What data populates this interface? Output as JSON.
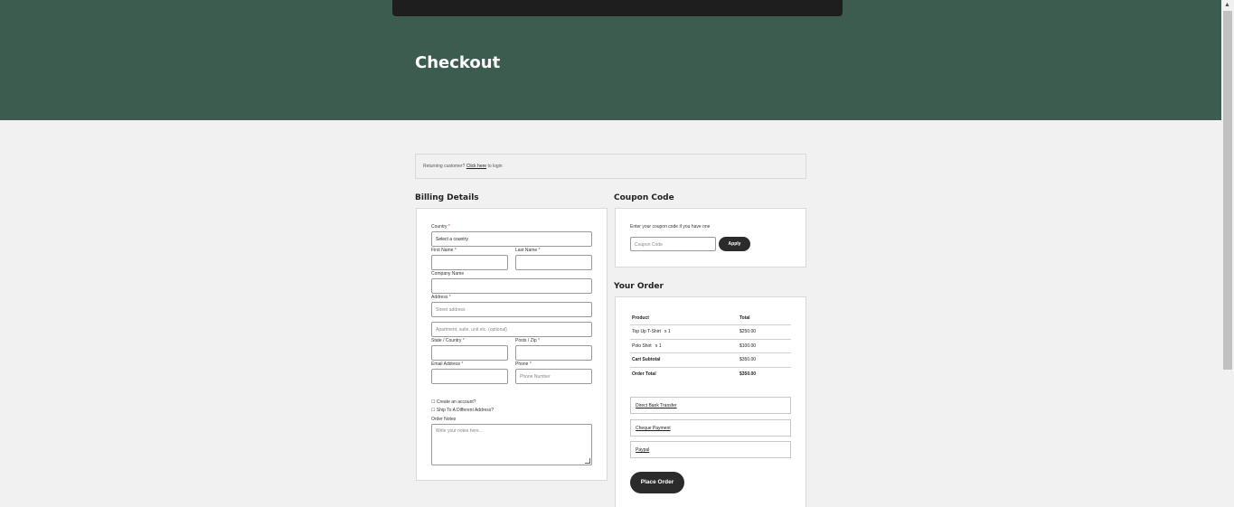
{
  "page": {
    "title": "Checkout"
  },
  "returning": {
    "prefix": "Returning customer?",
    "link": "Click here",
    "suffix": "to login"
  },
  "billing": {
    "title": "Billing Details",
    "country_label": "Country",
    "country_value": "Select a country",
    "first_name_label": "First Name",
    "last_name_label": "Last Name",
    "company_label": "Company Name",
    "address_label": "Address",
    "street_placeholder": "Street address",
    "apartment_placeholder": "Apartment, suite, unit etc. (optional)",
    "state_label": "State / Country",
    "postcode_label": "Posts / Zip",
    "email_label": "Email Address",
    "phone_label": "Phone",
    "phone_placeholder": "Phone Number",
    "create_account_label": "Create an account?",
    "ship_different_label": "Ship To A Different Address?",
    "order_notes_label": "Order Notes",
    "order_notes_placeholder": "Write your notes here...",
    "required_mark": "*",
    "checkbox_glyph": "☐"
  },
  "coupon": {
    "title": "Coupon Code",
    "hint": "Enter your coupon code if you have one",
    "placeholder": "Coupon Code",
    "apply_label": "Apply"
  },
  "order": {
    "title": "Your Order",
    "headers": {
      "product": "Product",
      "total": "Total"
    },
    "rows": [
      {
        "product": "Top Up T-Shirt",
        "qty": "x  1",
        "total": "$250.00"
      },
      {
        "product": "Polo Shirt",
        "qty": "x  1",
        "total": "$100.00"
      }
    ],
    "subtotal": {
      "label": "Cart Subtotal",
      "value": "$350.00"
    },
    "grand_total": {
      "label": "Order Total",
      "value": "$350.00"
    },
    "payments": [
      "Direct Bank Transfer",
      "Cheque Payment",
      "Paypal"
    ],
    "place_order_label": "Place Order"
  }
}
